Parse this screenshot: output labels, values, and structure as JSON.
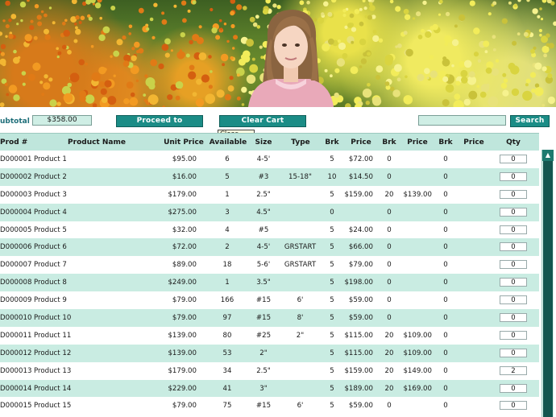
{
  "toolbar": {
    "subtotal_label": "ubtotal",
    "subtotal_value": "$358.00",
    "checkout_label": "Proceed to Checkout",
    "clear_label": "Clear Cart",
    "search_label": "Search",
    "search_value": "",
    "tooltip": "Clear Cart"
  },
  "table": {
    "headers": [
      "Prod #",
      "Product Name",
      "Unit Price",
      "Available",
      "Size",
      "Type",
      "Brk",
      "Price",
      "Brk",
      "Price",
      "Brk",
      "Price",
      "Qty"
    ],
    "rows": [
      [
        "D000001",
        "Product 1",
        "$95.00",
        "6",
        "4-5'",
        "",
        "5",
        "$72.00",
        "0",
        "",
        "0",
        "",
        "0"
      ],
      [
        "D000002",
        "Product 2",
        "$16.00",
        "5",
        "#3",
        "15-18\"",
        "10",
        "$14.50",
        "0",
        "",
        "0",
        "",
        "0"
      ],
      [
        "D000003",
        "Product 3",
        "$179.00",
        "1",
        "2.5\"",
        "",
        "5",
        "$159.00",
        "20",
        "$139.00",
        "0",
        "",
        "0"
      ],
      [
        "D000004",
        "Product 4",
        "$275.00",
        "3",
        "4.5\"",
        "",
        "0",
        "",
        "0",
        "",
        "0",
        "",
        "0"
      ],
      [
        "D000005",
        "Product 5",
        "$32.00",
        "4",
        "#5",
        "",
        "5",
        "$24.00",
        "0",
        "",
        "0",
        "",
        "0"
      ],
      [
        "D000006",
        "Product 6",
        "$72.00",
        "2",
        "4-5'",
        "GRSTART",
        "5",
        "$66.00",
        "0",
        "",
        "0",
        "",
        "0"
      ],
      [
        "D000007",
        "Product 7",
        "$89.00",
        "18",
        "5-6'",
        "GRSTART",
        "5",
        "$79.00",
        "0",
        "",
        "0",
        "",
        "0"
      ],
      [
        "D000008",
        "Product 8",
        "$249.00",
        "1",
        "3.5\"",
        "",
        "5",
        "$198.00",
        "0",
        "",
        "0",
        "",
        "0"
      ],
      [
        "D000009",
        "Product 9",
        "$79.00",
        "166",
        "#15",
        "6'",
        "5",
        "$59.00",
        "0",
        "",
        "0",
        "",
        "0"
      ],
      [
        "D000010",
        "Product 10",
        "$79.00",
        "97",
        "#15",
        "8'",
        "5",
        "$59.00",
        "0",
        "",
        "0",
        "",
        "0"
      ],
      [
        "D000011",
        "Product 11",
        "$139.00",
        "80",
        "#25",
        "2\"",
        "5",
        "$115.00",
        "20",
        "$109.00",
        "0",
        "",
        "0"
      ],
      [
        "D000012",
        "Product 12",
        "$139.00",
        "53",
        "2\"",
        "",
        "5",
        "$115.00",
        "20",
        "$109.00",
        "0",
        "",
        "0"
      ],
      [
        "D000013",
        "Product 13",
        "$179.00",
        "34",
        "2.5\"",
        "",
        "5",
        "$159.00",
        "20",
        "$149.00",
        "0",
        "",
        "2"
      ],
      [
        "D000014",
        "Product 14",
        "$229.00",
        "41",
        "3\"",
        "",
        "5",
        "$189.00",
        "20",
        "$169.00",
        "0",
        "",
        "0"
      ],
      [
        "D000015",
        "Product 15",
        "$79.00",
        "75",
        "#15",
        "6'",
        "5",
        "$59.00",
        "0",
        "",
        "0",
        "",
        "0"
      ]
    ]
  },
  "colors": {
    "accent": "#1b8c86",
    "row_alt": "#c9ece2",
    "header_bg": "#bfe6dc",
    "label": "#1f6f7a"
  },
  "icons": {
    "scroll_up": "chevron-up-icon"
  }
}
